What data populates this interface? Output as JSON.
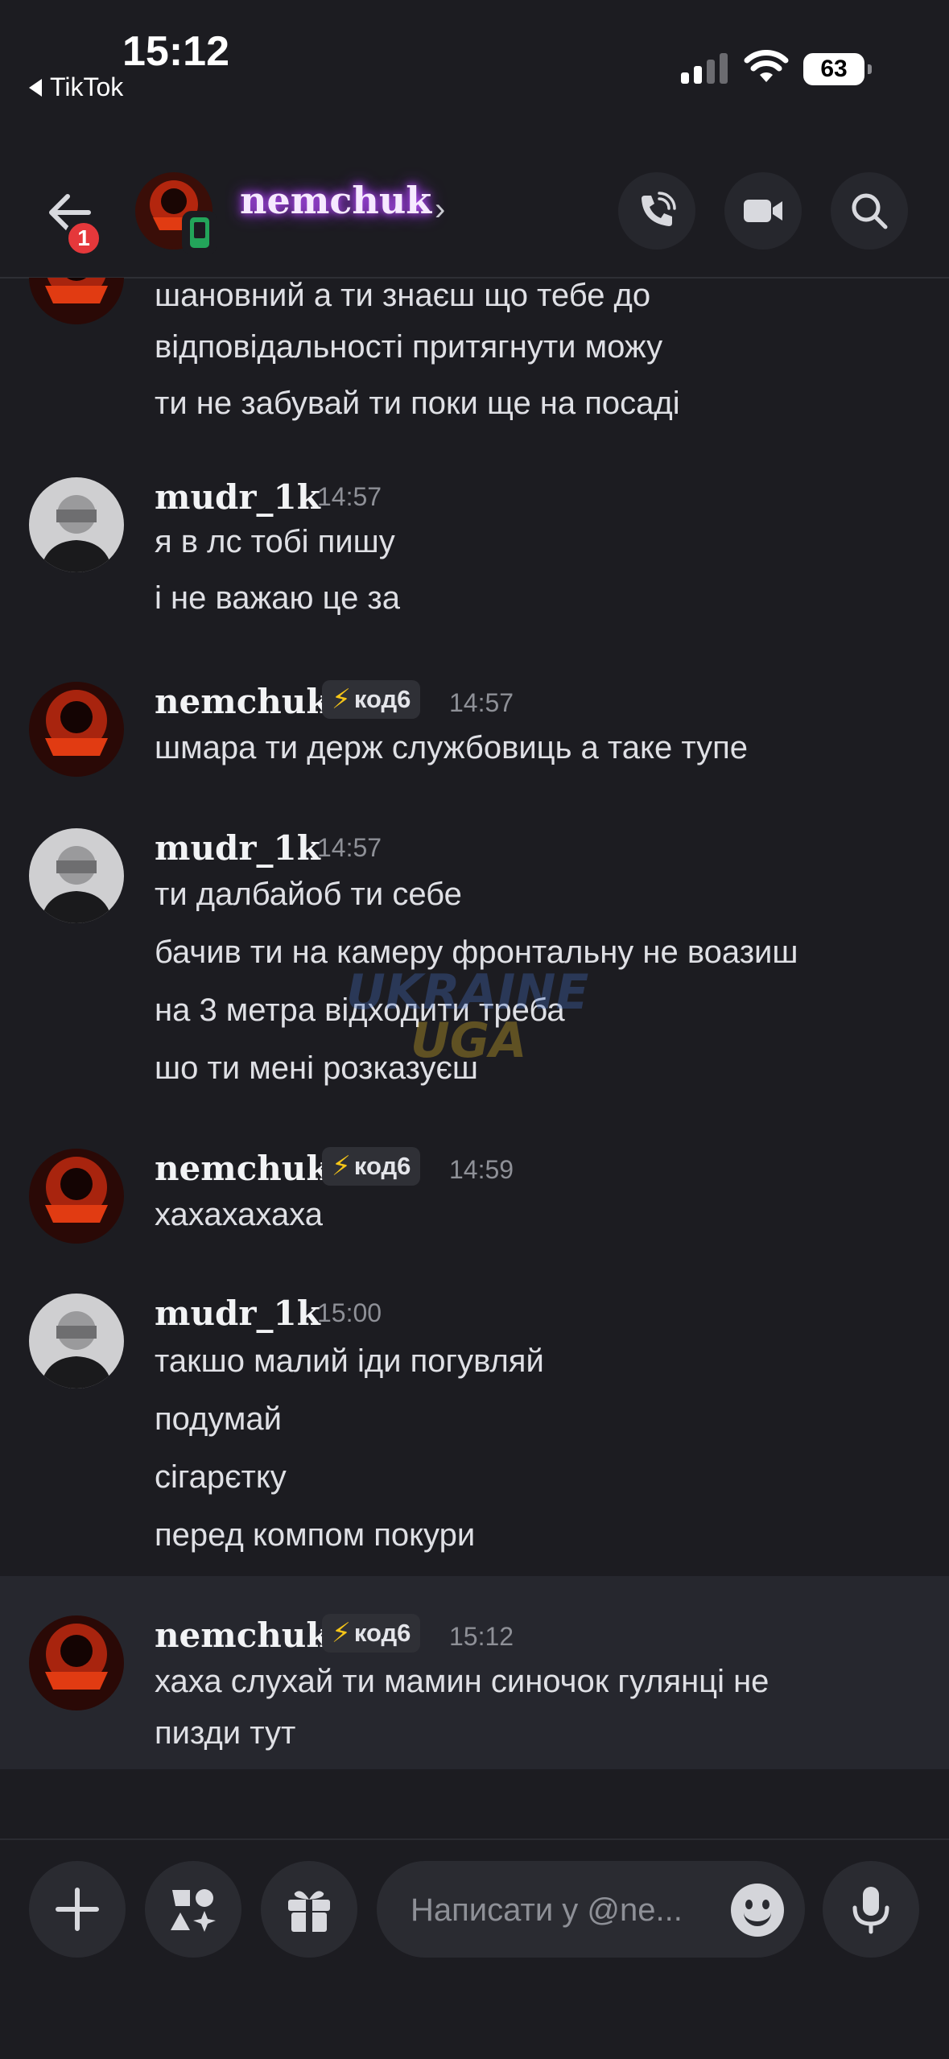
{
  "status_bar": {
    "time": "15:12",
    "back_app": "TikTok",
    "battery": "63"
  },
  "header": {
    "back_badge": "1",
    "channel_name": "nemchuk",
    "chevron": "›"
  },
  "messages": [
    {
      "lines": [
        "шановний а ти знаєш що тебе до",
        "відповідальності притягнути можу",
        "ти не забувай ти поки ще на посаді"
      ]
    },
    {
      "user": "mudr_1k",
      "time": "14:57",
      "lines": [
        "я в лс тобі пишу",
        "і не важаю це за"
      ]
    },
    {
      "user": "nemchuk",
      "role": "код6",
      "time": "14:57",
      "lines": [
        "шмара ти держ службовиць а таке тупе"
      ]
    },
    {
      "user": "mudr_1k",
      "time": "14:57",
      "lines": [
        "ти далбайоб ти себе",
        "бачив ти на камеру фронтальну не воазиш",
        "на 3 метра відходити треба",
        "шо ти мені розказуєш"
      ]
    },
    {
      "user": "nemchuk",
      "role": "код6",
      "time": "14:59",
      "lines": [
        "хахахахаха"
      ]
    },
    {
      "user": "mudr_1k",
      "time": "15:00",
      "lines": [
        "такшо малий іди погувляй",
        "подумай",
        "сігарєтку",
        "перед компом покури"
      ]
    },
    {
      "user": "nemchuk",
      "role": "код6",
      "time": "15:12",
      "lines": [
        "хаха слухай ти мамин синочок гулянці не",
        "пизди тут"
      ]
    }
  ],
  "watermark": {
    "line1": "UKRAINE",
    "line2": "UGA"
  },
  "composer": {
    "placeholder": "Написати у @ne..."
  },
  "colors": {
    "background": "#1c1c21",
    "username_glow": "#c056ff",
    "badge": "#e5383b",
    "mobile_indicator": "#23a55a",
    "bolt": "#f5c518"
  }
}
